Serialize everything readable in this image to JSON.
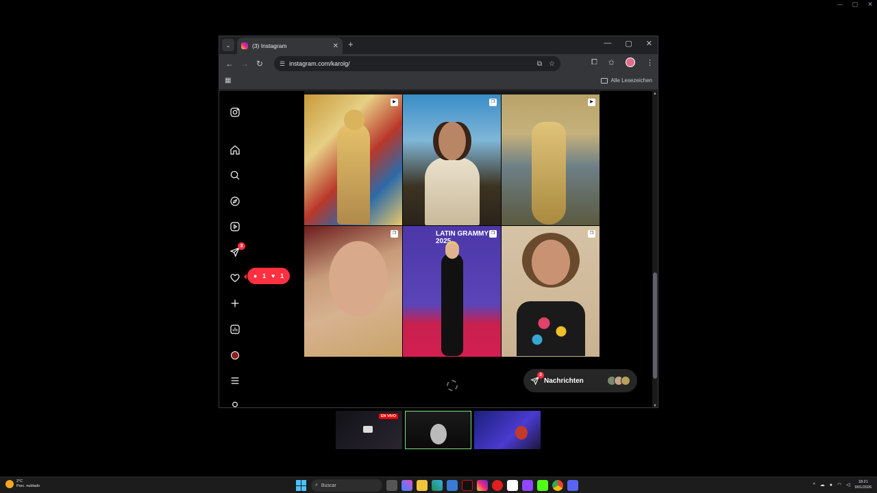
{
  "browser": {
    "tab_title": "(3) Instagram",
    "url": "instagram.com/karolg/",
    "bookmarks_label": "Alle Lesezeichen"
  },
  "sidebar": {
    "notifications_badge": "3",
    "notif_pill": {
      "comments": "1",
      "likes": "1"
    }
  },
  "grid": {
    "posts": [
      {
        "type": "reel",
        "alt_icon": "reel-icon"
      },
      {
        "type": "carousel",
        "alt_icon": "carousel-icon"
      },
      {
        "type": "reel",
        "alt_icon": "reel-icon"
      },
      {
        "type": "carousel",
        "alt_icon": "carousel-icon"
      },
      {
        "type": "carousel",
        "alt_icon": "carousel-icon",
        "caption": "LATIN GRAMMY 2025"
      },
      {
        "type": "carousel",
        "alt_icon": "carousel-icon"
      }
    ]
  },
  "messages": {
    "label": "Nachrichten",
    "badge": "3"
  },
  "stream": {
    "live_label": "EN VIVO"
  },
  "taskbar": {
    "weather_temp": "2°C",
    "weather_desc": "Parc. nublado",
    "search_placeholder": "Buscar",
    "time": "18:21",
    "date": "9/01/2026"
  },
  "colors": {
    "accent": "#ff3040",
    "chrome_bg": "#202124",
    "toolbar_bg": "#35363a"
  }
}
